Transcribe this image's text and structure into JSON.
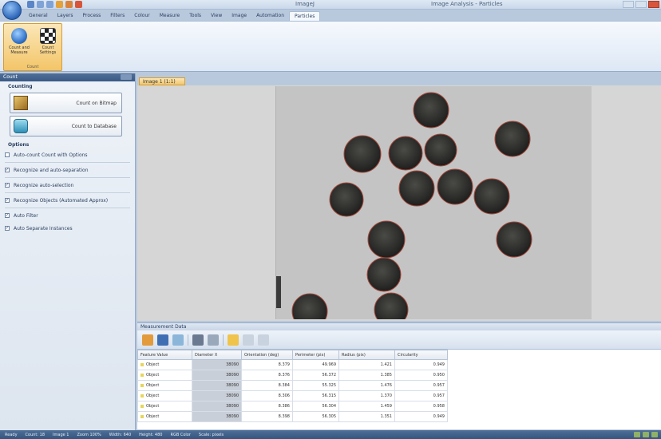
{
  "window": {
    "title": "ImageJ",
    "right_title": "Image Analysis - Particles"
  },
  "ribbon": {
    "tabs": [
      "General",
      "Layers",
      "Process",
      "Filters",
      "Colour",
      "Measure",
      "Tools",
      "View",
      "Image",
      "Automation",
      "Particles"
    ],
    "active_tab": "Particles",
    "group_label": "Count",
    "buttons": [
      {
        "label": "Count and Measure",
        "icon": "globe-icon"
      },
      {
        "label": "Count Settings",
        "icon": "checkerboard-icon"
      }
    ]
  },
  "left_panel": {
    "title": "Count",
    "section_counting": "Counting",
    "action_bitmap": "Count on Bitmap",
    "action_database": "Count to Database",
    "section_options": "Options",
    "options": [
      {
        "label": "Auto-count Count with Options",
        "checked": false
      },
      {
        "label": "Recognize and auto-separation",
        "checked": true
      },
      {
        "label": "Recognize auto-selection",
        "checked": true
      },
      {
        "label": "Recognize Objects (Automated Approx)",
        "checked": true
      },
      {
        "label": "Auto Filter",
        "checked": true
      },
      {
        "label": "Auto Separate Instances",
        "checked": true
      }
    ]
  },
  "document": {
    "tab_label": "Image 1 (1:1)"
  },
  "results": {
    "title": "Measurement Data",
    "columns": [
      "Feature Value",
      "Diameter X",
      "Orientation (deg)",
      "Perimeter (pix)",
      "Radius (pix)",
      "Circularity"
    ],
    "rows": [
      [
        "Object",
        "38090",
        "8.379",
        "49.969",
        "1.421",
        "0.949"
      ],
      [
        "Object",
        "38090",
        "8.376",
        "56.372",
        "1.385",
        "0.950"
      ],
      [
        "Object",
        "38090",
        "8.384",
        "55.325",
        "1.476",
        "0.957"
      ],
      [
        "Object",
        "38090",
        "8.306",
        "56.315",
        "1.370",
        "0.957"
      ],
      [
        "Object",
        "38090",
        "8.386",
        "56.304",
        "1.459",
        "0.958"
      ],
      [
        "Object",
        "38090",
        "8.398",
        "56.305",
        "1.351",
        "0.949"
      ]
    ]
  },
  "statusbar": {
    "items": [
      "Ready",
      "Count: 18",
      "Image 1",
      "Zoom 100%",
      "Width: 640",
      "Height: 480",
      "RGB Color",
      "Scale: pixels"
    ]
  },
  "colors": {
    "accent_orange": "#f3c568",
    "panel_blue": "#3a5a86"
  }
}
